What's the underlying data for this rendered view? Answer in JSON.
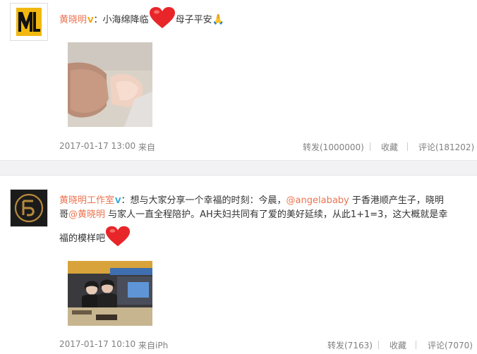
{
  "post1": {
    "author": "黄晓明",
    "verified_badge": "V",
    "colon": "：",
    "text_before_heart": "小海绵降临",
    "text_after_heart": "母子平安",
    "heart_icon": "red-heart-icon",
    "pray_icon": "praying-hands-icon",
    "time": "2017-01-17 13:00",
    "source_label": "来自",
    "repost": "转发(1000000)",
    "favorite": "收藏",
    "comment": "评论(181202)"
  },
  "post2": {
    "author": "黄晓明工作室",
    "verified_badge": "V",
    "line1_a": "：想与大家分享一个幸福的时刻：今晨，",
    "mention1": "@angelababy",
    "line1_b": " 于香港顺产生子，晓明",
    "line2_a": "哥",
    "mention2": "@黄晓明",
    "line2_b": " 与家人一直全程陪护。AH夫妇共同有了爱的美好延续，从此1+1=3，这大概就是幸",
    "line3": "福的模样吧",
    "heart_icon": "red-heart-icon",
    "time": "2017-01-17 10:10",
    "source": "来自iPh",
    "repost": "转发(7163)",
    "favorite": "收藏",
    "comment": "评论(7070)"
  },
  "colors": {
    "name": "#eb7350",
    "mention": "#eb7350",
    "badge_orange": "#f7a300",
    "badge_blue": "#2ea9df",
    "meta": "#808080",
    "heart": "#e8262a"
  }
}
